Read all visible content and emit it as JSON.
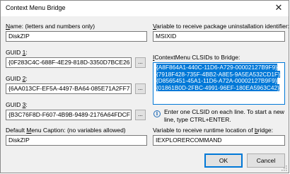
{
  "window": {
    "title": "Context Menu Bridge",
    "close_glyph": "✕"
  },
  "name": {
    "label_pre": "",
    "label_mnemonic": "N",
    "label_post": "ame: (letters and numbers only)",
    "value": "DiskZIP"
  },
  "uninstall_var": {
    "label_pre": "",
    "label_mnemonic": "V",
    "label_post": "ariable to receive package uninstallation identifier:",
    "value": "MSIXID"
  },
  "guid1": {
    "label_pre": "GUID ",
    "label_mnemonic": "1",
    "label_post": ":",
    "value": "{0F283C4C-688F-4E29-818D-3350D7BCE26"
  },
  "guid2": {
    "label_pre": "GUID ",
    "label_mnemonic": "2",
    "label_post": ":",
    "value": "{6AA013CF-EF5A-4497-BA64-085E71A2FF7"
  },
  "guid3": {
    "label_pre": "GUID ",
    "label_mnemonic": "3",
    "label_post": ":",
    "value": "{B3C76F8D-F607-4B9B-9489-2176A64FDCF"
  },
  "ellipsis_label": "...",
  "clsids": {
    "label_pre": "",
    "label_mnemonic": "I",
    "label_post": "ContextMenu CLSIDs to Bridge:",
    "items": [
      "{A8F864A1-440C-11D6-A729-00002127B9F9}",
      "{7918F428-735F-4BB2-A8E5-9A5EA532CD1F}",
      "{D8565451-45A1-11D6-A72A-00002127B9F9}",
      "{01861B0D-2FBC-4991-96EF-180EA5963C42}"
    ]
  },
  "hint": {
    "icon": "info-icon",
    "text": "Enter one CLSID on each line. To start a new line, type CTRL+ENTER."
  },
  "caption": {
    "label_pre": "Default ",
    "label_mnemonic": "M",
    "label_post": "enu Caption: (no variables allowed)",
    "value": "DiskZIP"
  },
  "bridge_var": {
    "label_pre": "Variable to receive runtime location of ",
    "label_mnemonic": "b",
    "label_post": "ridge:",
    "value": "IEXPLORERCOMMAND"
  },
  "buttons": {
    "ok": "OK",
    "cancel": "Cancel"
  },
  "colors": {
    "selection": "#0078d7",
    "window_bg": "#f0f0f0"
  }
}
